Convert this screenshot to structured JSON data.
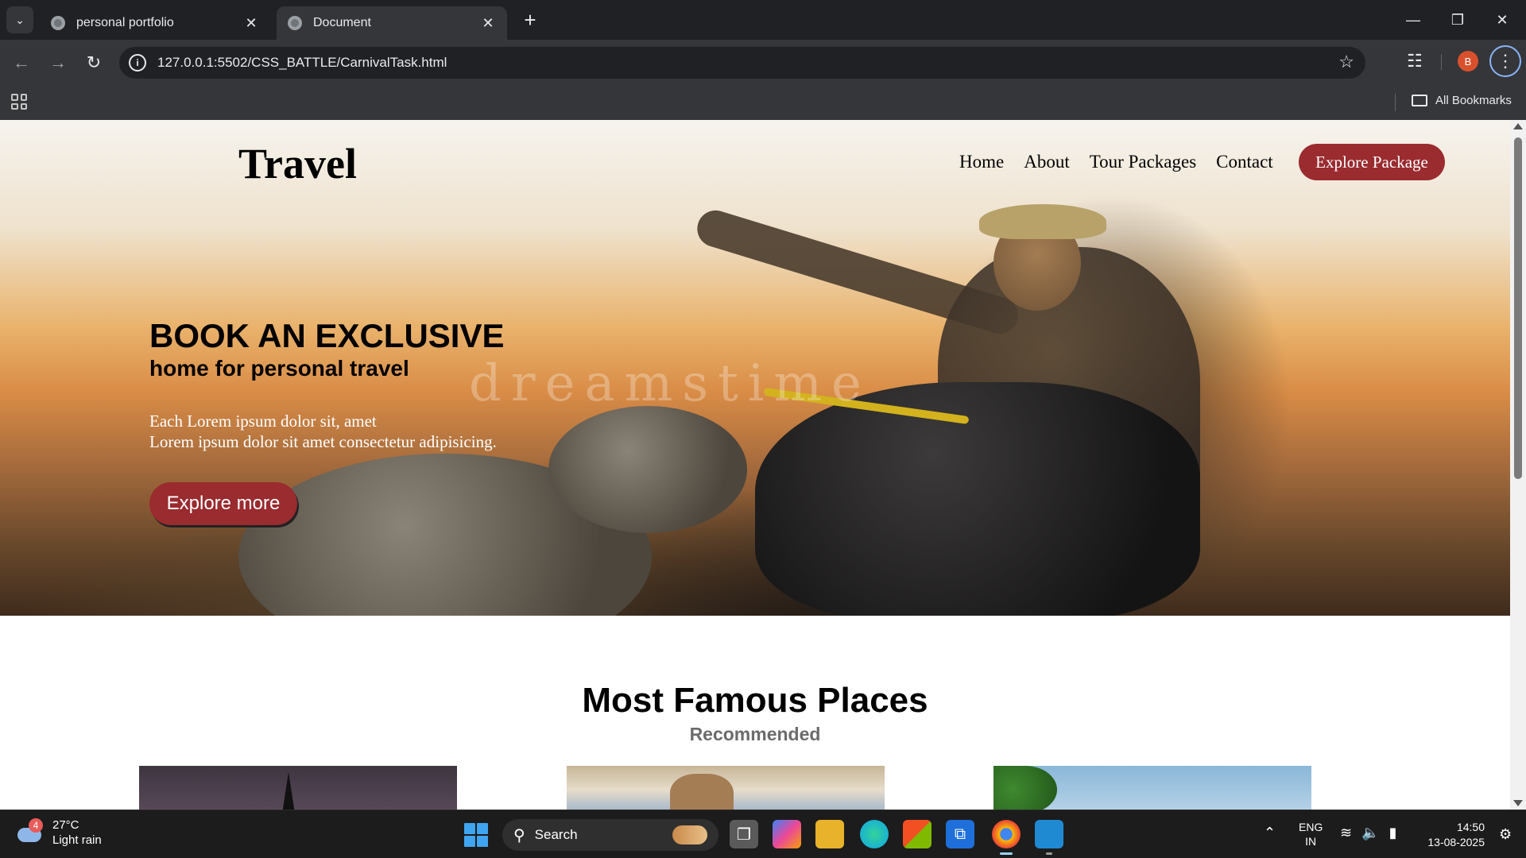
{
  "browser": {
    "tabs": [
      {
        "title": "personal portfolio",
        "active": false
      },
      {
        "title": "Document",
        "active": true
      }
    ],
    "new_tab_symbol": "+",
    "url": "127.0.0.1:5502/CSS_BATTLE/CarnivalTask.html",
    "profile_initial": "B",
    "bookmarks_label": "All Bookmarks"
  },
  "site": {
    "logo": "Travel",
    "nav": [
      "Home",
      "About",
      "Tour Packages",
      "Contact"
    ],
    "cta_top": "Explore Package",
    "hero": {
      "heading": "BOOK AN EXCLUSIVE",
      "subheading": "home for personal travel",
      "paragraph_line1": "Each Lorem ipsum dolor sit, amet",
      "paragraph_line2": "Lorem ipsum dolor sit amet consectetur adipisicing.",
      "button": "Explore more",
      "watermark": "dreamstime"
    },
    "section": {
      "title": "Most Famous Places",
      "subtitle": "Recommended"
    }
  },
  "taskbar": {
    "weather_temp": "27°C",
    "weather_desc": "Light rain",
    "weather_badge": "4",
    "search_label": "Search",
    "lang_line1": "ENG",
    "lang_line2": "IN",
    "time": "14:50",
    "date": "13-08-2025"
  },
  "colors": {
    "accent": "#9a2b2f",
    "chrome_dark": "#202124",
    "chrome_toolbar": "#35363a"
  }
}
